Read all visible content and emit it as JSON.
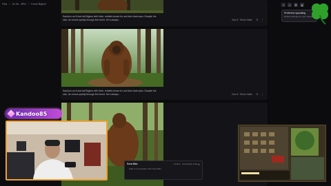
{
  "breadcrumb": [
    "Files",
    "/",
    "Jul 06 – 8RI2",
    "/",
    "Forest Bigfoot"
  ],
  "cards": [
    {
      "caption": "Sasha is an 8-foot tall Bigfoot with thick, reddish-brown fur and kind dark eyes. Despite his size, he moves quietly through the forest. He's always...",
      "meta": "Nov 8 · Text to Video"
    },
    {
      "caption": "Sasha is an 8-foot tall Bigfoot with thick, reddish-brown fur and kind dark eyes. Despite his size, he moves quietly through the forest. He's always...",
      "meta": "Nov 8 · Text to Video"
    },
    {
      "caption": "",
      "meta": ""
    }
  ],
  "card_actions": [
    "⎘",
    "⋮"
  ],
  "toolbar_icons": [
    "+",
    "⌂",
    "⚙",
    "◍"
  ],
  "notification": {
    "title": "Preferred upscaling",
    "text": "Default settings for your videos"
  },
  "streamer": {
    "name": "Kandoo85"
  },
  "chat": {
    "title": "Sora Max",
    "status": "• Online · Generating Frame",
    "message": "Start a conversation with Sora Max...",
    "close": "×"
  },
  "colors": {
    "badge_gradient_start": "#6a2bb9",
    "badge_gradient_end": "#c04cd8",
    "webcam_border": "#f0a030",
    "clover": "#2fa12b"
  }
}
